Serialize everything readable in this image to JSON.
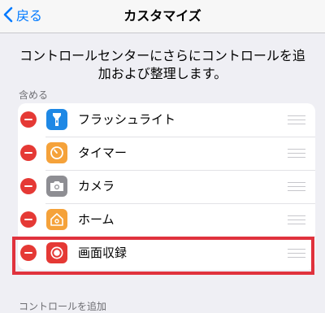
{
  "nav": {
    "back_label": "戻る",
    "title": "カスタマイズ"
  },
  "description": "コントロールセンターにさらにコントロールを追加および整理します。",
  "included": {
    "header": "含める",
    "items": [
      {
        "label": "フラッシュライト",
        "icon": "flashlight-icon",
        "color": "#1e88e5"
      },
      {
        "label": "タイマー",
        "icon": "timer-icon",
        "color": "#f5a23a"
      },
      {
        "label": "カメラ",
        "icon": "camera-icon",
        "color": "#8e8e93"
      },
      {
        "label": "ホーム",
        "icon": "home-icon",
        "color": "#f5a23a"
      },
      {
        "label": "画面収録",
        "icon": "screen-recording-icon",
        "color": "#e53935"
      }
    ]
  },
  "more_controls": {
    "header": "コントロールを追加"
  },
  "colors": {
    "accent": "#007aff",
    "delete": "#e53935",
    "highlight": "#e0323d"
  }
}
